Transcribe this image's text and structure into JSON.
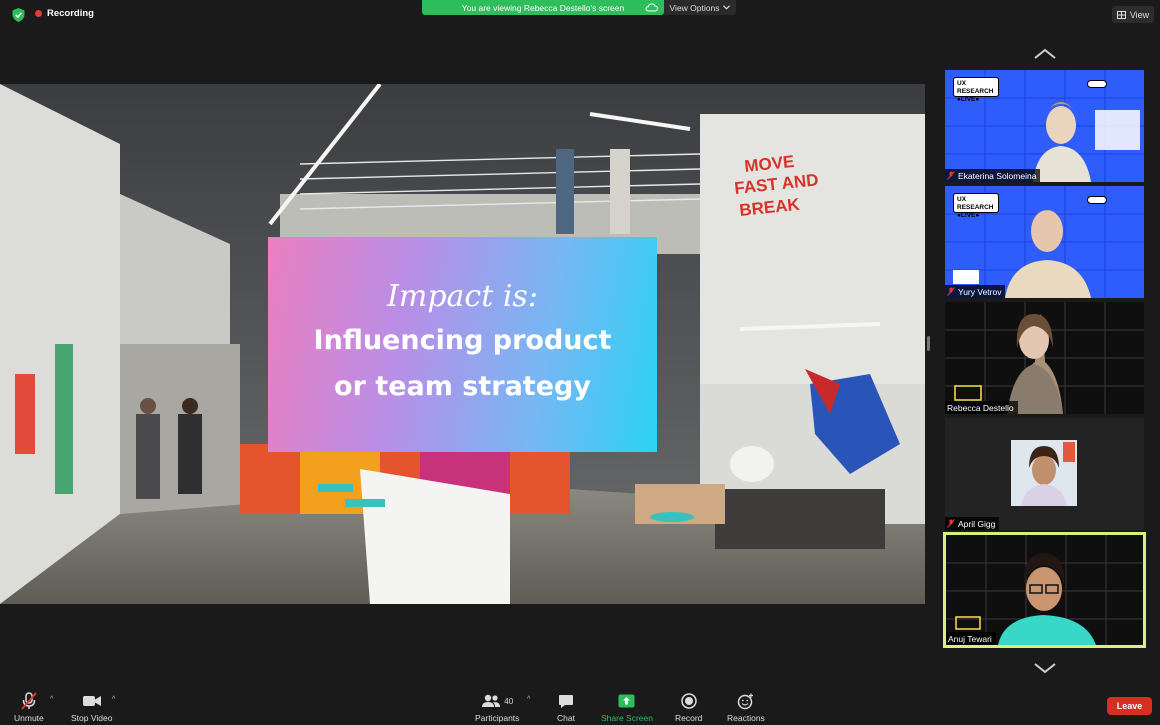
{
  "top_bar": {
    "recording_label": "Recording",
    "viewing_banner": "You are viewing Rebecca Destello's screen",
    "view_options_label": "View Options",
    "view_button_label": "View"
  },
  "slide": {
    "script_title": "Impact is:",
    "line1": "Influencing product",
    "line2": "or team strategy"
  },
  "participants": [
    {
      "name": "Ekaterina Solomeina",
      "muted": true,
      "badge_line1": "UX RESEARCH",
      "badge_line2": "●LIVE●"
    },
    {
      "name": "Yury Vetrov",
      "muted": true,
      "badge_line1": "UX RESEARCH",
      "badge_line2": "●LIVE●"
    },
    {
      "name": "Rebecca Destello",
      "muted": false
    },
    {
      "name": "April Gigg",
      "muted": true
    },
    {
      "name": "Anuj Tewari",
      "muted": false,
      "active_speaker": true
    }
  ],
  "toolbar": {
    "unmute_label": "Unmute",
    "stop_video_label": "Stop Video",
    "participants_label": "Participants",
    "participants_count": "40",
    "chat_label": "Chat",
    "share_screen_label": "Share Screen",
    "record_label": "Record",
    "reactions_label": "Reactions",
    "leave_label": "Leave"
  },
  "colors": {
    "share_green": "#2dbd5a",
    "leave_red": "#d92d20",
    "active_border": "#d7f27a",
    "tile_blue": "#2f5dfc"
  }
}
